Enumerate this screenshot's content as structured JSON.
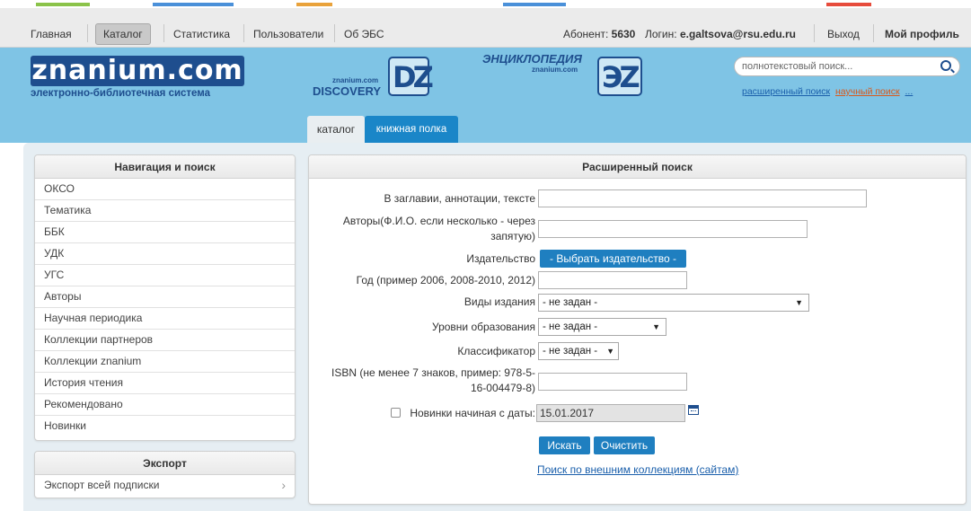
{
  "topnav": {
    "items": [
      "Главная",
      "Каталог",
      "Статистика",
      "Пользователи",
      "Об ЭБС"
    ],
    "subscriber_label": "Абонент:",
    "subscriber_id": "5630",
    "login_label": "Логин:",
    "login_value": "e.galtsova@rsu.edu.ru",
    "logout": "Выход",
    "profile": "Мой профиль"
  },
  "header": {
    "logo_text": "znanium.com",
    "logo_subtitle": "электронно-библиотечная система",
    "discovery_small": "znanium.com",
    "discovery_text": "DISCOVERY",
    "encyclopedia_text": "ЭНЦИКЛОПЕДИЯ",
    "encyclopedia_small": "znanium.com",
    "badge_dz": "DZ",
    "badge_ez": "ЭZ",
    "search_placeholder": "полнотекстовый поиск...",
    "link_advanced": "расширенный поиск",
    "link_scientific": "научный поиск",
    "link_more": "...",
    "tab_catalog": "каталог",
    "tab_shelf": "книжная полка"
  },
  "sidebar": {
    "nav_title": "Навигация и поиск",
    "nav_items": [
      "ОКСО",
      "Тематика",
      "ББК",
      "УДК",
      "УГС",
      "Авторы",
      "Научная периодика",
      "Коллекции партнеров",
      "Коллекции znanium",
      "История чтения",
      "Рекомендовано",
      "Новинки"
    ],
    "export_title": "Экспорт",
    "export_item": "Экспорт всей подписки",
    "export_chevron": "›"
  },
  "search_form": {
    "title": "Расширенный поиск",
    "label_title": "В заглавии, аннотации, тексте",
    "label_authors": "Авторы(Ф.И.О. если несколько - через запятую)",
    "label_publisher": "Издательство",
    "btn_publisher": "- Выбрать издательство -",
    "label_year": "Год (пример 2006, 2008-2010, 2012)",
    "label_kind": "Виды издания",
    "kind_value": "- не задан -",
    "label_level": "Уровни образования",
    "level_value": "- не задан -",
    "label_classifier": "Классификатор",
    "classifier_value": "- не задан -",
    "label_isbn": "ISBN (не менее 7 знаков, пример: 978-5-16-004479-8)",
    "label_newsince": "Новинки начиная с даты:",
    "date_value": "15.01.2017",
    "btn_search": "Искать",
    "btn_clear": "Очистить",
    "external_link": "Поиск по внешним коллекциям (сайтам)"
  }
}
